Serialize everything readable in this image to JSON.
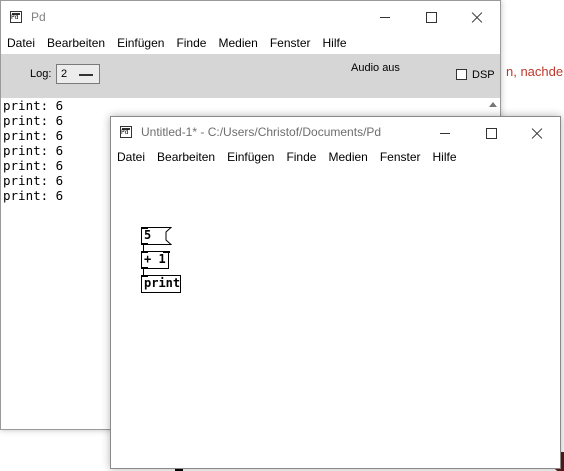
{
  "background": {
    "partial_text": "n, nachdem"
  },
  "pd_window": {
    "title": "Pd",
    "menu": [
      "Datei",
      "Bearbeiten",
      "Einfügen",
      "Finde",
      "Medien",
      "Fenster",
      "Hilfe"
    ],
    "toolbar": {
      "log_label": "Log:",
      "log_value": "2",
      "audio_status": "Audio aus",
      "dsp_label": "DSP",
      "dsp_checked": false
    },
    "console_lines": [
      "print: 6",
      "print: 6",
      "print: 6",
      "print: 6",
      "print: 6",
      "print: 6",
      "print: 6"
    ]
  },
  "patch_window": {
    "title": "Untitled-1* - C:/Users/Christof/Documents/Pd",
    "menu": [
      "Datei",
      "Bearbeiten",
      "Einfügen",
      "Finde",
      "Medien",
      "Fenster",
      "Hilfe"
    ],
    "objects": {
      "message": "5",
      "add": "+ 1",
      "print": "print"
    }
  }
}
